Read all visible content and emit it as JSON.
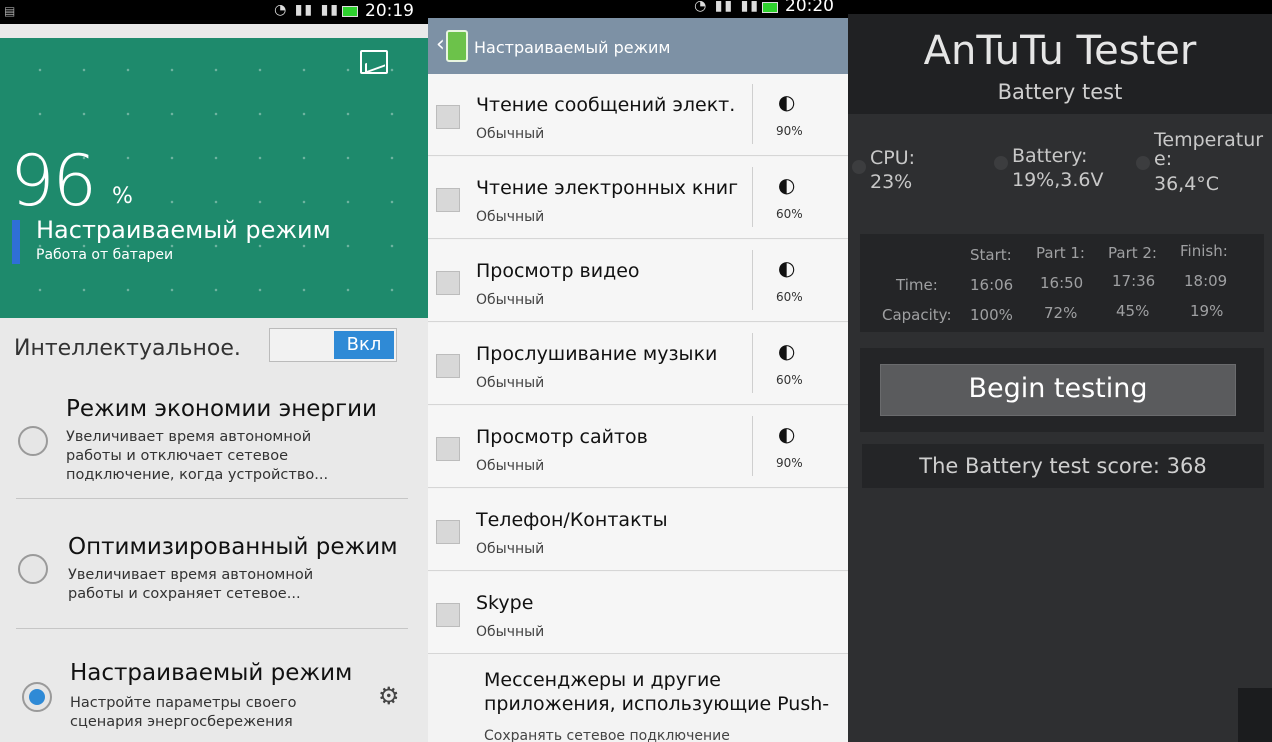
{
  "screen1": {
    "status_time": "20:19",
    "battery_percent": "96",
    "percent_sign": "%",
    "mode_title": "Настраиваемый режим",
    "mode_subtitle": "Работа от батареи",
    "smart_label": "Интеллектуальное.",
    "toggle_label": "Вкл",
    "modes": [
      {
        "title": "Режим экономии энергии",
        "desc": "Увеличивает время автономной работы и отключает сетевое подключение, когда устройство...",
        "selected": false
      },
      {
        "title": "Оптимизированный режим",
        "desc": "Увеличивает время автономной работы и сохраняет сетевое...",
        "selected": false
      },
      {
        "title": "Настраиваемый режим",
        "desc": "Настройте параметры своего сценария энергосбережения",
        "selected": true
      }
    ]
  },
  "screen2": {
    "status_time": "20:20",
    "header_title": "Настраиваемый режим",
    "apps": [
      {
        "name": "Чтение сообщений элект.",
        "mode": "Обычный",
        "brightness": "90%"
      },
      {
        "name": "Чтение электронных книг",
        "mode": "Обычный",
        "brightness": "60%"
      },
      {
        "name": "Просмотр видео",
        "mode": "Обычный",
        "brightness": "60%"
      },
      {
        "name": "Прослушивание музыки",
        "mode": "Обычный",
        "brightness": "60%"
      },
      {
        "name": "Просмотр сайтов",
        "mode": "Обычный",
        "brightness": "90%"
      },
      {
        "name": "Телефон/Контакты",
        "mode": "Обычный",
        "brightness": ""
      },
      {
        "name": "Skype",
        "mode": "Обычный",
        "brightness": ""
      }
    ],
    "last_item": "Мессенджеры и другие приложения, использующие Push-",
    "last_item_sub": "Сохранять сетевое подключение"
  },
  "screen3": {
    "app_title": "AnTuTu Tester",
    "subtitle": "Battery test",
    "cpu_label": "CPU:",
    "cpu_value": "23%",
    "battery_label": "Battery:",
    "battery_value": "19%,3.6V",
    "temp_label_1": "Temperatur",
    "temp_label_2": "e:",
    "temp_value": "36,4°C",
    "col_headers": [
      "Start:",
      "Part 1:",
      "Part 2:",
      "Finish:"
    ],
    "time_label": "Time:",
    "times": [
      "16:06",
      "16:50",
      "17:36",
      "18:09"
    ],
    "capacity_label": "Capacity:",
    "capacities": [
      "100%",
      "72%",
      "45%",
      "19%"
    ],
    "begin_button": "Begin testing",
    "score_text": "The Battery test score: 368"
  }
}
